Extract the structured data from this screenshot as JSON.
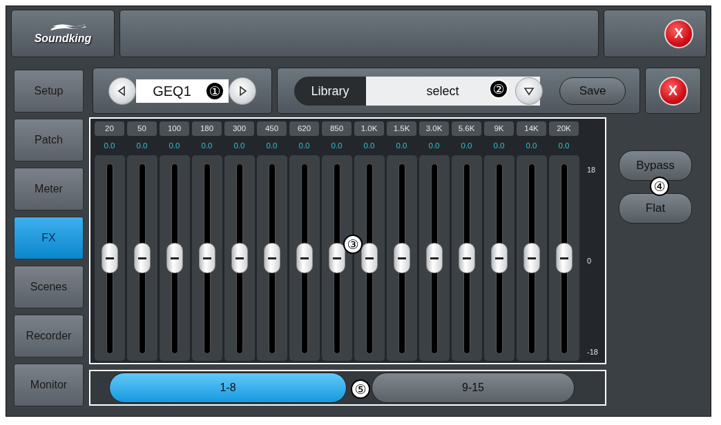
{
  "header": {
    "logo": "Soundking",
    "close": "X"
  },
  "sidebar": {
    "items": [
      {
        "label": "Setup",
        "selected": false
      },
      {
        "label": "Patch",
        "selected": false
      },
      {
        "label": "Meter",
        "selected": false
      },
      {
        "label": "FX",
        "selected": true
      },
      {
        "label": "Scenes",
        "selected": false
      },
      {
        "label": "Recorder",
        "selected": false
      },
      {
        "label": "Monitor",
        "selected": false
      }
    ]
  },
  "effect_selector": {
    "name": "GEQ1",
    "callout": "①"
  },
  "library": {
    "label": "Library",
    "value": "select",
    "callout": "②",
    "save": "Save",
    "close": "X"
  },
  "eq": {
    "callout": "③",
    "scale": [
      "18",
      "0",
      "-18"
    ],
    "bands": [
      {
        "freq": "20",
        "reading": "0.0",
        "level": 0.5
      },
      {
        "freq": "50",
        "reading": "0.0",
        "level": 0.5
      },
      {
        "freq": "100",
        "reading": "0.0",
        "level": 0.5
      },
      {
        "freq": "180",
        "reading": "0.0",
        "level": 0.5
      },
      {
        "freq": "300",
        "reading": "0.0",
        "level": 0.5
      },
      {
        "freq": "450",
        "reading": "0.0",
        "level": 0.5
      },
      {
        "freq": "620",
        "reading": "0.0",
        "level": 0.5
      },
      {
        "freq": "850",
        "reading": "0.0",
        "level": 0.5
      },
      {
        "freq": "1.0K",
        "reading": "0.0",
        "level": 0.5
      },
      {
        "freq": "1.5K",
        "reading": "0.0",
        "level": 0.5
      },
      {
        "freq": "3.0K",
        "reading": "0.0",
        "level": 0.5
      },
      {
        "freq": "5.6K",
        "reading": "0.0",
        "level": 0.5
      },
      {
        "freq": "9K",
        "reading": "0.0",
        "level": 0.5
      },
      {
        "freq": "14K",
        "reading": "0.0",
        "level": 0.5
      },
      {
        "freq": "20K",
        "reading": "0.0",
        "level": 0.5
      }
    ]
  },
  "actions": {
    "buttons": [
      "Bypass",
      "Flat"
    ],
    "callout": "④"
  },
  "pages": {
    "callout": "⑤",
    "tabs": [
      {
        "label": "1-8",
        "selected": true
      },
      {
        "label": "9-15",
        "selected": false
      }
    ]
  }
}
